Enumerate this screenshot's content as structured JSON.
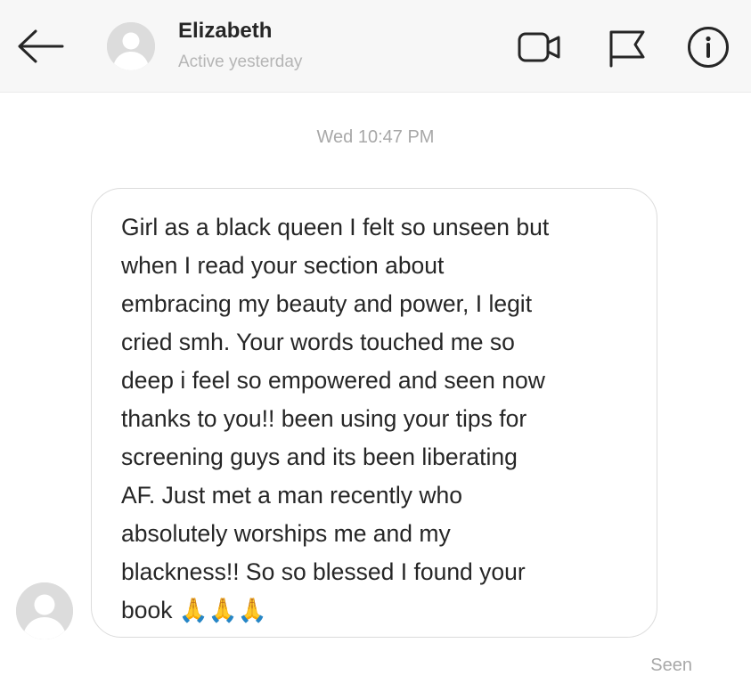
{
  "header": {
    "contact_name": "Elizabeth",
    "contact_status": "Active yesterday",
    "icons": {
      "back": "arrow-left-icon",
      "video": "video-camera-icon",
      "flag": "flag-icon",
      "info": "info-icon"
    }
  },
  "thread": {
    "timestamp": "Wed 10:47 PM",
    "message": {
      "sender": "Elizabeth",
      "text": "Girl as a black queen I felt so unseen but\nwhen I read your section about\nembracing my beauty and power, I legit\ncried smh. Your words touched me so\ndeep i feel so empowered and seen now\nthanks to you!! been using your tips for\nscreening guys and its been liberating\nAF. Just met a man recently who\nabsolutely worships me and my\nblackness!! So so blessed I found your\nbook 🙏🙏🙏"
    },
    "read_receipt": "Seen"
  },
  "colors": {
    "header_bg": "#f7f7f7",
    "text_primary": "#262626",
    "text_muted": "#a8a8a8",
    "bubble_border": "#dbdbdb",
    "avatar_bg": "#dcdcdc"
  }
}
